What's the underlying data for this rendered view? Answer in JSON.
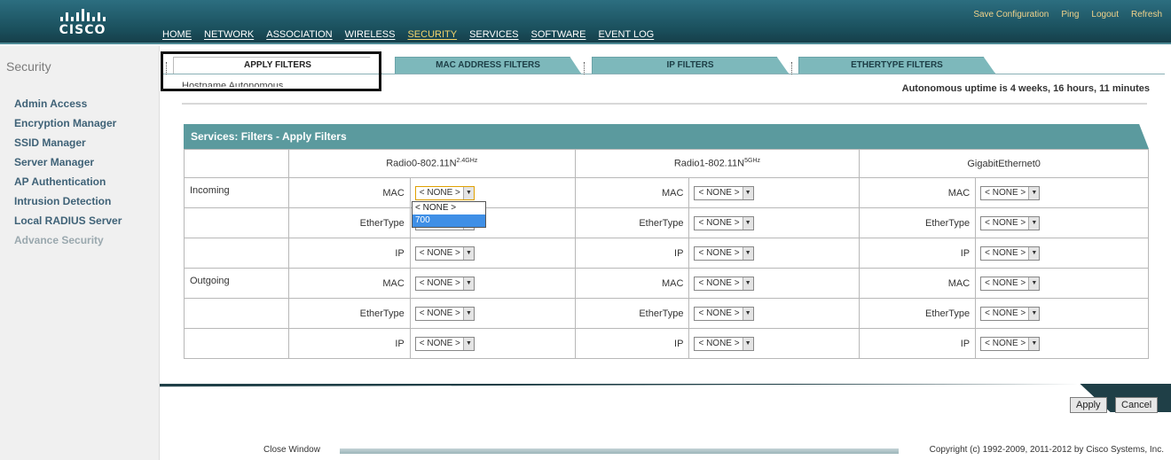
{
  "header": {
    "logo_text": "CISCO",
    "nav": [
      "HOME",
      "NETWORK",
      "ASSOCIATION",
      "WIRELESS",
      "SECURITY",
      "SERVICES",
      "SOFTWARE",
      "EVENT LOG"
    ],
    "active_nav": "SECURITY",
    "top_links": [
      "Save Configuration",
      "Ping",
      "Logout",
      "Refresh"
    ]
  },
  "sidebar": {
    "title": "Security",
    "items": [
      "Admin Access",
      "Encryption Manager",
      "SSID Manager",
      "Server Manager",
      "AP Authentication",
      "Intrusion Detection",
      "Local RADIUS Server",
      "Advance Security"
    ]
  },
  "tabs": [
    "APPLY FILTERS",
    "MAC ADDRESS FILTERS",
    "IP FILTERS",
    "ETHERTYPE FILTERS"
  ],
  "hostname": "Hostname Autonomous",
  "uptime": "Autonomous uptime is 4 weeks, 16 hours, 11 minutes",
  "panel": {
    "title": "Services: Filters - Apply Filters",
    "columns": [
      {
        "name": "Radio0-802.11N",
        "sup": "2.4GHz"
      },
      {
        "name": "Radio1-802.11N",
        "sup": "5GHz"
      },
      {
        "name": "GigabitEthernet0",
        "sup": ""
      }
    ],
    "row_groups": [
      "Incoming",
      "Outgoing"
    ],
    "filter_types": [
      "MAC",
      "EtherType",
      "IP"
    ],
    "select_value": "< NONE >",
    "dropdown_options": [
      "< NONE >",
      "700"
    ]
  },
  "buttons": {
    "apply": "Apply",
    "cancel": "Cancel"
  },
  "footer": {
    "close": "Close Window",
    "copyright": "Copyright (c) 1992-2009, 2011-2012 by Cisco Systems, Inc."
  },
  "colors": {
    "header": "#1a4f5c",
    "tab": "#7db8bb",
    "panel_header": "#5b9a9e",
    "dark_bar": "#1f3f47"
  }
}
